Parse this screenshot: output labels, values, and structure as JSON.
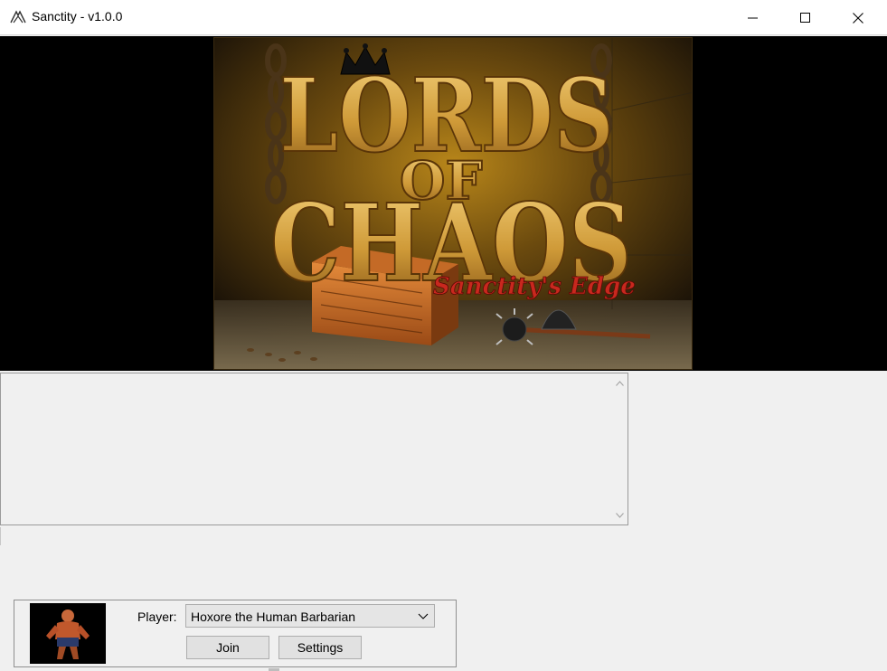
{
  "window": {
    "title": "Sanctity - v1.0.0",
    "app_icon": "sanctity-logo-icon",
    "controls": [
      "minimize-icon",
      "maximize-icon",
      "close-icon"
    ]
  },
  "banner": {
    "title_line1": "LORDS",
    "title_line2": "OF",
    "title_line3": "CHAOS",
    "subtitle": "Sanctity's Edge"
  },
  "log": {
    "content": ""
  },
  "player_panel": {
    "label": "Player:",
    "selected_player": "Hoxore the Human Barbarian",
    "join_label": "Join",
    "settings_label": "Settings",
    "portrait_icon": "barbarian-portrait"
  },
  "colors": {
    "title_gold": "#d9a640",
    "subtitle_red": "#c8281e",
    "banner_bg": "#000000"
  }
}
